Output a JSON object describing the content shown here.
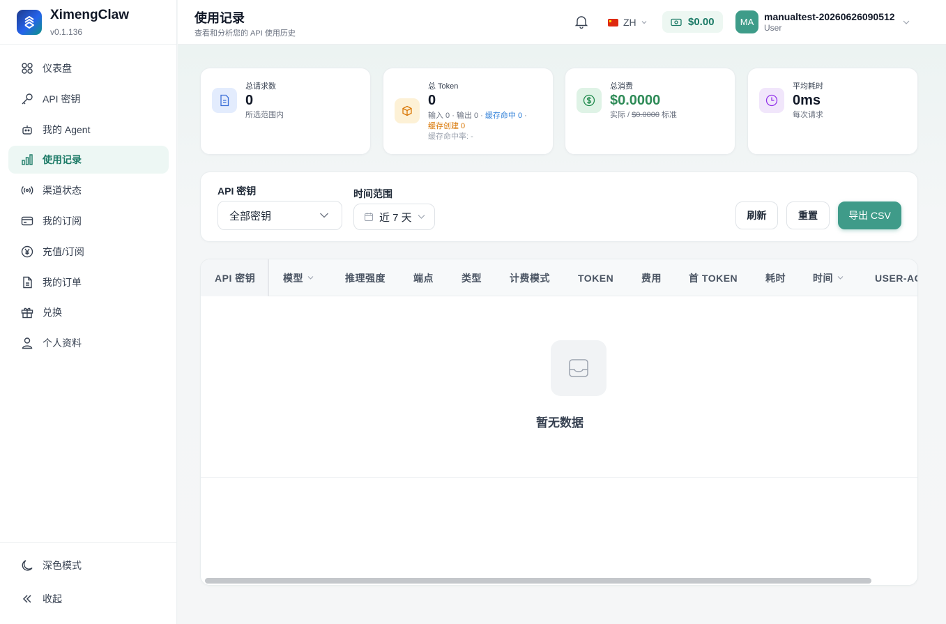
{
  "app": {
    "name": "XimengClaw",
    "version": "v0.1.136"
  },
  "sidebar": {
    "items": [
      {
        "label": "仪表盘",
        "icon": "dashboard-icon"
      },
      {
        "label": "API 密钥",
        "icon": "key-icon"
      },
      {
        "label": "我的 Agent",
        "icon": "robot-icon"
      },
      {
        "label": "使用记录",
        "icon": "bar-chart-icon",
        "active": true
      },
      {
        "label": "渠道状态",
        "icon": "signal-icon"
      },
      {
        "label": "我的订阅",
        "icon": "card-icon"
      },
      {
        "label": "充值/订阅",
        "icon": "yen-icon"
      },
      {
        "label": "我的订单",
        "icon": "document-icon"
      },
      {
        "label": "兑换",
        "icon": "gift-icon"
      },
      {
        "label": "个人资料",
        "icon": "user-icon"
      }
    ],
    "bottom": [
      {
        "label": "深色模式",
        "icon": "moon-icon"
      },
      {
        "label": "收起",
        "icon": "collapse-icon"
      }
    ]
  },
  "header": {
    "title": "使用记录",
    "subtitle": "查看和分析您的 API 使用历史",
    "language": "ZH",
    "balance": "$0.00",
    "user": {
      "initials": "MA",
      "name": "manualtest-20260626090512",
      "role": "User"
    }
  },
  "stats": {
    "requests": {
      "label": "总请求数",
      "value": "0",
      "note": "所选范围内"
    },
    "tokens": {
      "label": "总 Token",
      "value": "0",
      "detail_input": "输入 0 · 输出 0 · ",
      "detail_cache_hit": "缓存命中 0",
      "detail_sep": " · ",
      "detail_cache_create": "缓存创建 0",
      "hit_rate": "缓存命中率: -"
    },
    "cost": {
      "label": "总消费",
      "value": "$0.0000",
      "note_prefix": "实际 / ",
      "note_standard": "$0.0000",
      "note_suffix": " 标准"
    },
    "latency": {
      "label": "平均耗时",
      "value": "0ms",
      "note": "每次请求"
    }
  },
  "filters": {
    "api_key_label": "API 密钥",
    "api_key_value": "全部密钥",
    "time_range_label": "时间范围",
    "time_range_value": "近 7 天",
    "refresh": "刷新",
    "reset": "重置",
    "export": "导出 CSV"
  },
  "table": {
    "columns": [
      "API 密钥",
      "模型",
      "推理强度",
      "端点",
      "类型",
      "计费模式",
      "TOKEN",
      "费用",
      "首 TOKEN",
      "耗时",
      "时间",
      "USER-AG"
    ],
    "empty_text": "暂无数据"
  },
  "colors": {
    "accent": "#3f9b89",
    "active_bg": "#edf7f4",
    "active_text": "#1b7a66"
  }
}
